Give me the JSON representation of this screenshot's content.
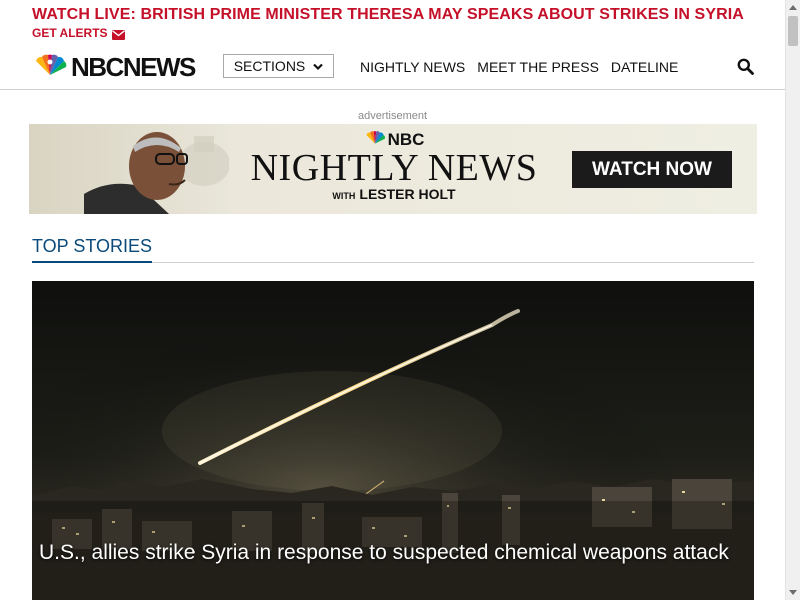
{
  "alert": {
    "headline": "WATCH LIVE: BRITISH PRIME MINISTER THERESA MAY SPEAKS ABOUT STRIKES IN SYRIA",
    "cta": "GET ALERTS",
    "cta_icon": "envelope-icon",
    "color": "#c5102a"
  },
  "header": {
    "logo_text": "NBCNEWS",
    "logo_icon": "peacock-icon",
    "sections_label": "SECTIONS",
    "sections_icon": "chevron-down-icon",
    "nav": [
      {
        "label": "NIGHTLY NEWS"
      },
      {
        "label": "MEET THE PRESS"
      },
      {
        "label": "DATELINE"
      }
    ],
    "search_icon": "search-icon"
  },
  "ad": {
    "label": "advertisement",
    "brand": "NBC",
    "title": "NIGHTLY NEWS",
    "with_label": "WITH",
    "anchor": "LESTER HOLT",
    "cta": "WATCH NOW"
  },
  "top_stories": {
    "title": "TOP STORIES",
    "accent": "#0a4a7a",
    "hero": {
      "headline": "U.S., allies strike Syria in response to suspected chemical weapons attack"
    }
  }
}
